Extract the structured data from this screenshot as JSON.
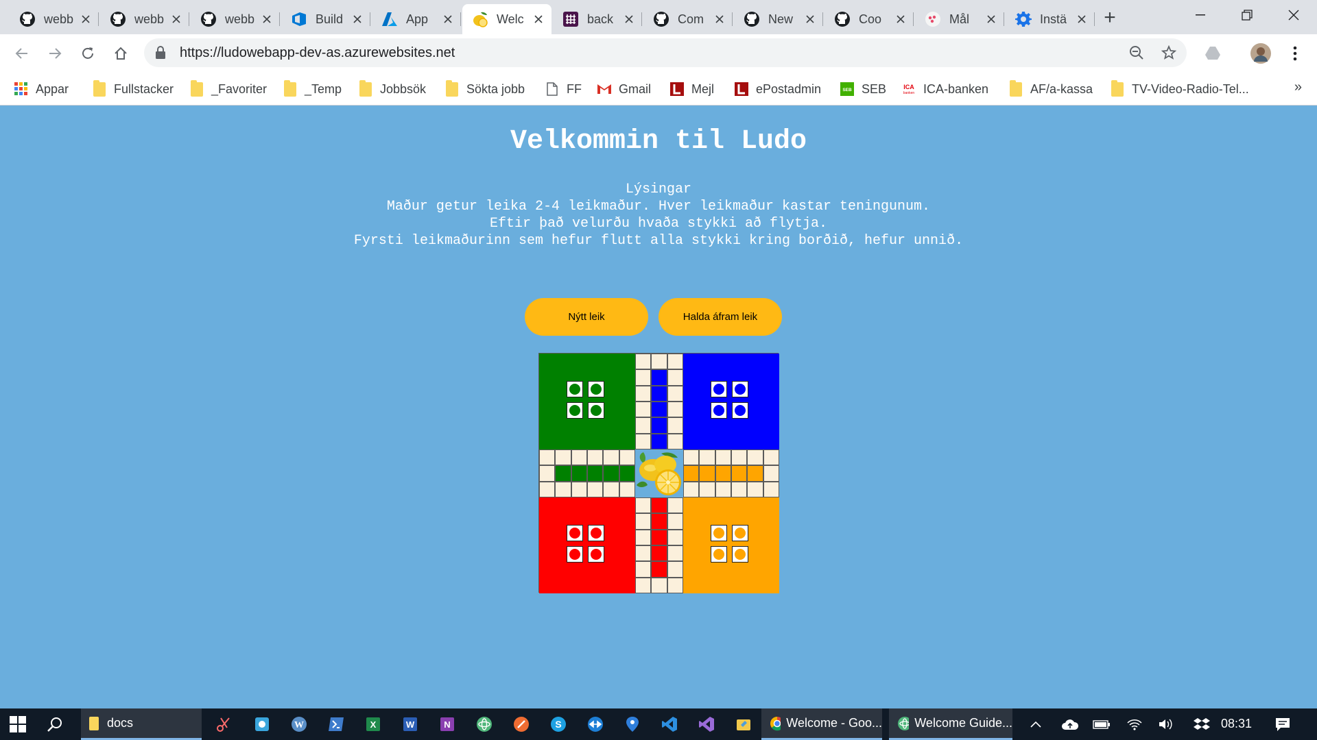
{
  "browser": {
    "tabs": [
      {
        "title": "webb",
        "icon": "github-icon"
      },
      {
        "title": "webb",
        "icon": "github-icon"
      },
      {
        "title": "webb",
        "icon": "github-icon"
      },
      {
        "title": "Build",
        "icon": "azure-devops-icon"
      },
      {
        "title": "App",
        "icon": "azure-icon"
      },
      {
        "title": "Welc",
        "icon": "lemon-icon",
        "active": true
      },
      {
        "title": "back",
        "icon": "slack-icon"
      },
      {
        "title": "Com",
        "icon": "github-icon"
      },
      {
        "title": "New",
        "icon": "github-icon"
      },
      {
        "title": "Coo",
        "icon": "github-icon"
      },
      {
        "title": "Mål",
        "icon": "dots-icon"
      },
      {
        "title": "Instä",
        "icon": "gear-icon"
      }
    ],
    "url": "https://ludowebapp-dev-as.azurewebsites.net",
    "bookmarks": [
      {
        "label": "Appar",
        "icon": "apps-grid-icon"
      },
      {
        "label": "Fullstacker",
        "icon": "folder-icon"
      },
      {
        "label": "_Favoriter",
        "icon": "folder-icon"
      },
      {
        "label": "_Temp",
        "icon": "folder-icon"
      },
      {
        "label": "Jobbsök",
        "icon": "folder-icon"
      },
      {
        "label": "Sökta jobb",
        "icon": "folder-icon"
      },
      {
        "label": "FF",
        "icon": "page-icon"
      },
      {
        "label": "Gmail",
        "icon": "gmail-icon"
      },
      {
        "label": "Mejl",
        "icon": "l-logo-icon"
      },
      {
        "label": "ePostadmin",
        "icon": "l-logo-icon"
      },
      {
        "label": "SEB",
        "icon": "seb-icon"
      },
      {
        "label": "ICA-banken",
        "icon": "ica-icon"
      },
      {
        "label": "AF/a-kassa",
        "icon": "folder-icon"
      },
      {
        "label": "TV-Video-Radio-Tel...",
        "icon": "folder-icon"
      }
    ],
    "bookmarks_more": "»"
  },
  "page": {
    "title": "Velkommin til Ludo",
    "description": [
      "Lýsingar",
      "Maður getur leika 2-4 leikmaður. Hver leikmaður kastar teningunum.",
      "Eftir það velurðu hvaða stykki að flytja.",
      "Fyrsti leikmaðurinn sem hefur flutt alla stykki kring borðið, hefur unnið."
    ],
    "buttons": {
      "new_game": "Nýtt leik",
      "continue_game": "Halda áfram leik"
    }
  },
  "board": {
    "colors": {
      "green": "#008000",
      "blue": "#0000ff",
      "red": "#ff0000",
      "yellow": "#ffa500",
      "path": "#fbf0dc"
    },
    "pieces_per_player": 4
  },
  "taskbar": {
    "explorer_label": "docs",
    "apps": [
      {
        "label": "Welcome - Goo...",
        "icon": "chrome-icon"
      },
      {
        "label": "Welcome Guide...",
        "icon": "atom-icon"
      }
    ],
    "clock": "08:31"
  }
}
